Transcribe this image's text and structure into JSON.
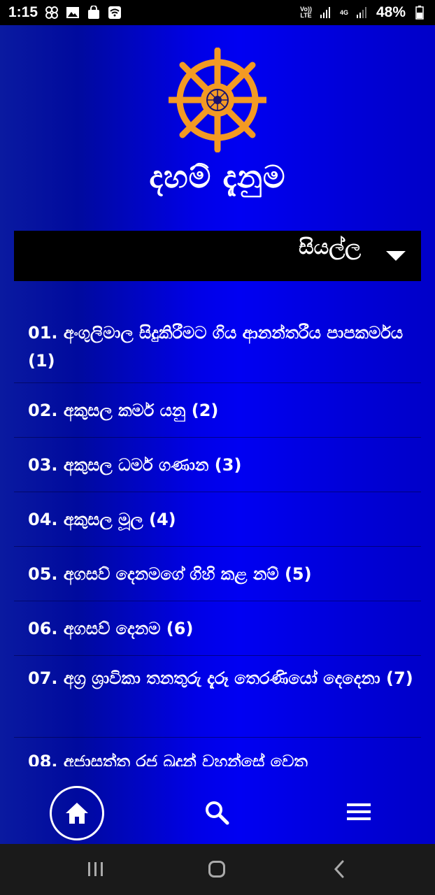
{
  "status_bar": {
    "time": "1:15",
    "network_label_top": "Vo))",
    "network_label_bottom": "LTE",
    "signal_4g": "4G",
    "battery": "48%"
  },
  "app": {
    "title": "දහම් දැනුම",
    "logo_icon": "dharma-wheel-icon",
    "category_select": {
      "value": "සියල්ල"
    },
    "items": [
      {
        "label": "01. අංගුලිමාල සිදුකිරීමට ගිය ආනන්තරීය පාපකර්මය (1)"
      },
      {
        "label": "02. අකුසල කර්ම යනු (2)"
      },
      {
        "label": "03. අකුසල ධර්ම ගණාන (3)"
      },
      {
        "label": "04. අකුසල මූල (4)"
      },
      {
        "label": "05. අගසව් දෙනමගේ ගිහි කළ නම් (5)"
      },
      {
        "label": "06. අගසව් දෙනම (6)"
      },
      {
        "label": "07. අග්‍ර ශ්‍රාවිකා තනතුරු දැරූ තෙරණියෝ දෙදෙනා (7)"
      },
      {
        "label": "08. අජාසත්ත රජ බුදුන් වහන්සේ වෙත"
      }
    ],
    "bottom_nav": [
      "home-icon",
      "search-icon",
      "menu-icon"
    ]
  },
  "colors": {
    "accent_logo": "#f39a23",
    "app_background": "#0000e6",
    "select_background": "#000000"
  }
}
